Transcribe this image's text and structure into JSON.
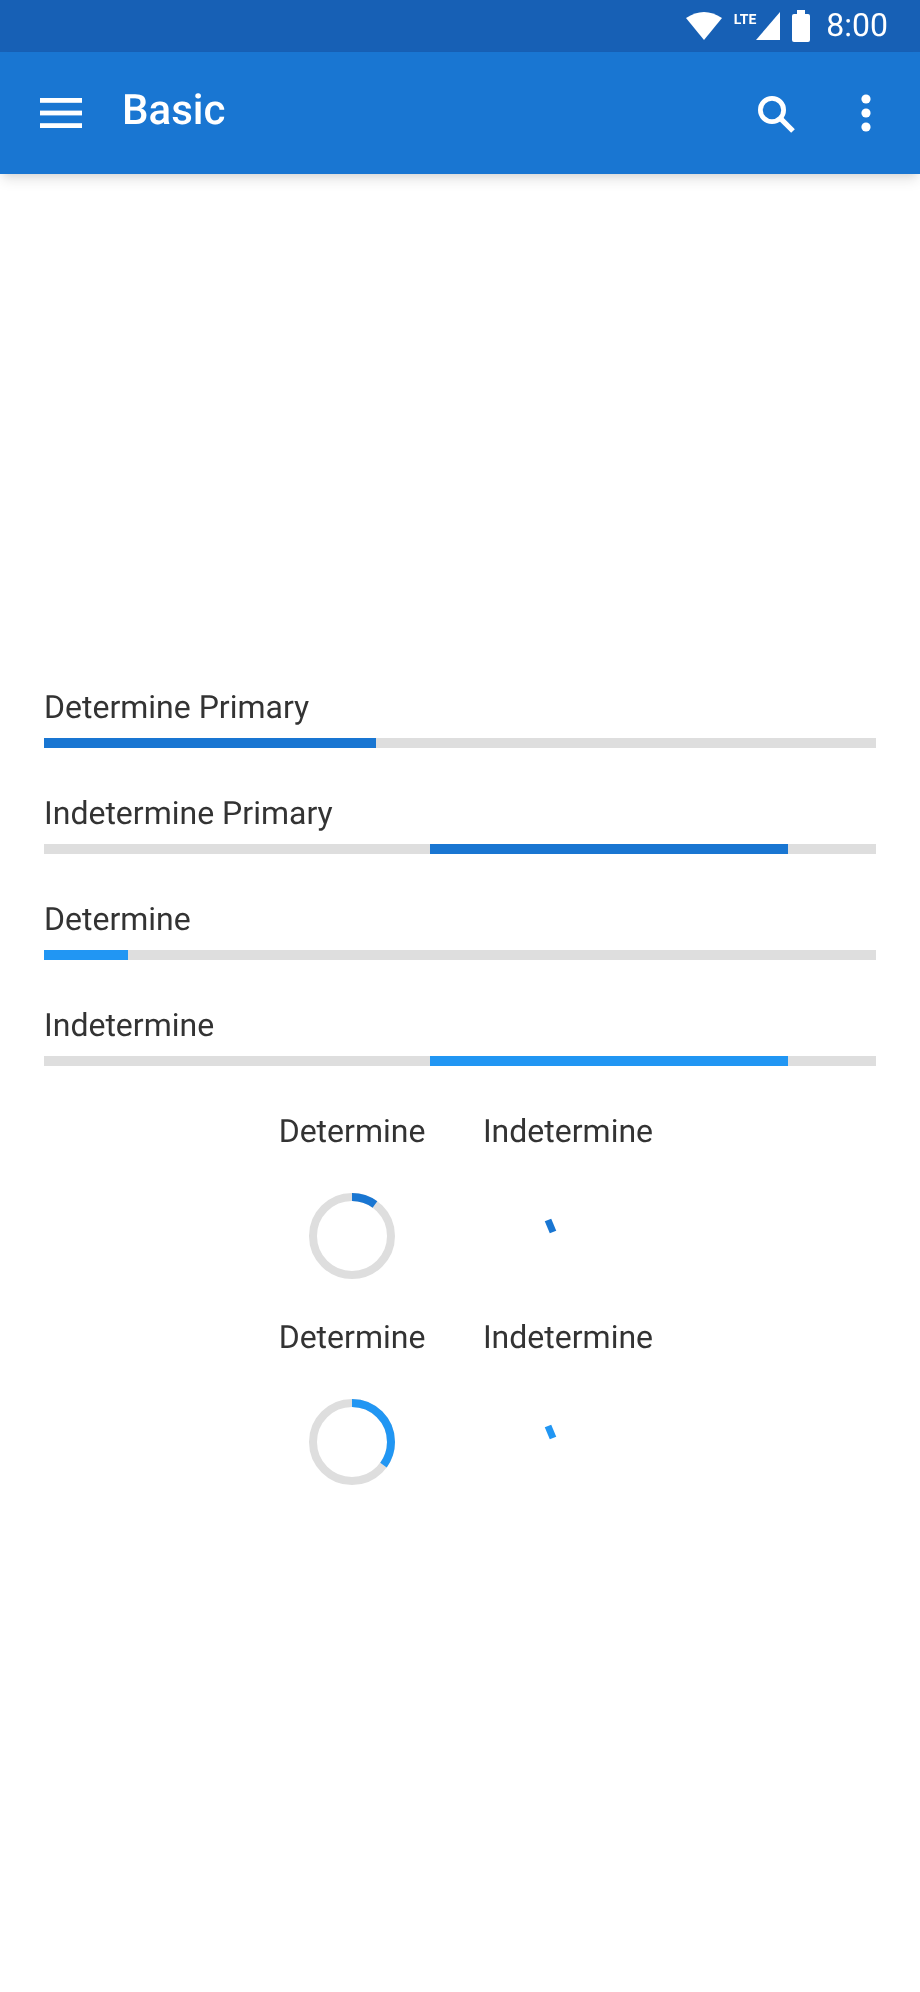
{
  "status_bar": {
    "time": "8:00",
    "network": "LTE"
  },
  "app_bar": {
    "title": "Basic"
  },
  "linear_progress": [
    {
      "label": "Determine Primary",
      "kind": "determinate",
      "color": "#1976d2",
      "level": 0.4
    },
    {
      "label": "Indetermine Primary",
      "kind": "indeterminate",
      "color": "#1976d2"
    },
    {
      "label": "Determine",
      "kind": "determinate",
      "color": "#2196f3",
      "level": 0.1
    },
    {
      "label": "Indetermine",
      "kind": "indeterminate",
      "color": "#2196f3"
    }
  ],
  "circular_progress": [
    [
      {
        "label": "Determine",
        "kind": "determinate",
        "color": "#1976d2",
        "level": 0.1
      },
      {
        "label": "Indetermine",
        "kind": "indeterminate",
        "color": "#1976d2"
      }
    ],
    [
      {
        "label": "Determine",
        "kind": "determinate",
        "color": "#2196f3",
        "level": 0.35
      },
      {
        "label": "Indetermine",
        "kind": "indeterminate",
        "color": "#2196f3"
      }
    ]
  ]
}
